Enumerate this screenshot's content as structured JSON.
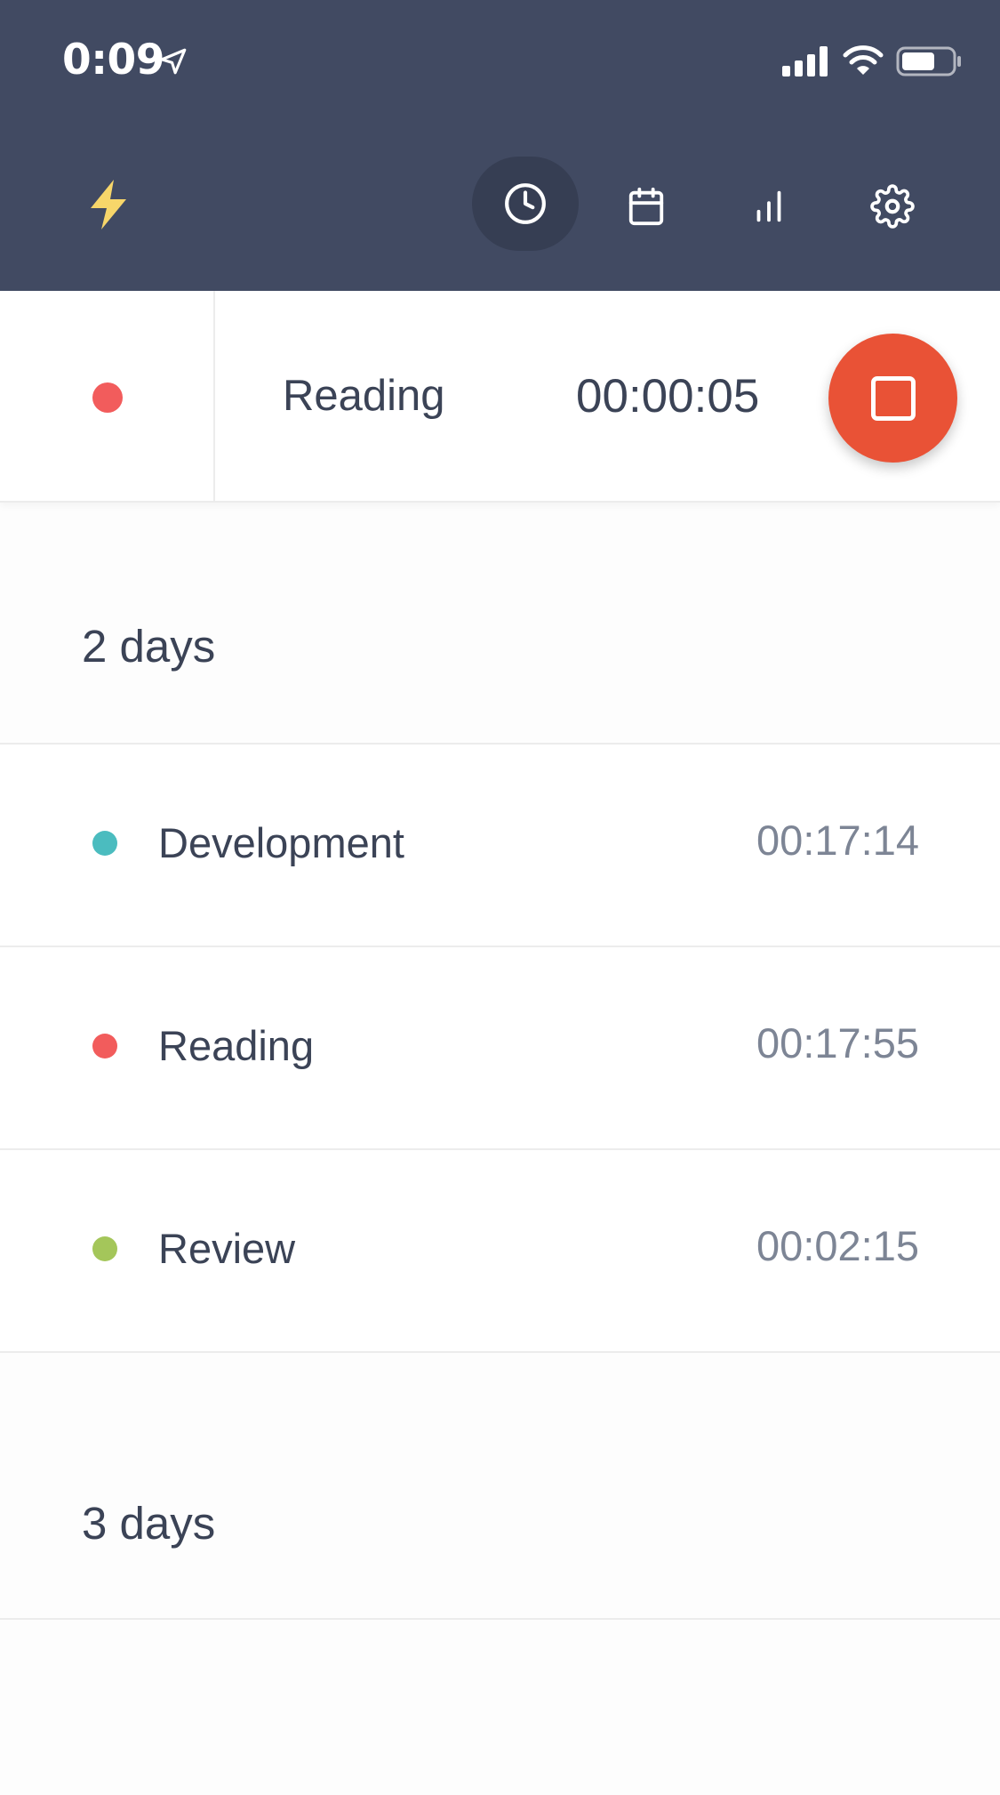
{
  "status_bar": {
    "time": "0:09"
  },
  "toolbar": {
    "logo_icon": "lightning-bolt-icon",
    "nav": [
      {
        "icon": "clock-icon",
        "active": true
      },
      {
        "icon": "calendar-icon",
        "active": false
      },
      {
        "icon": "bar-chart-icon",
        "active": false
      },
      {
        "icon": "gear-icon",
        "active": false
      }
    ]
  },
  "current_timer": {
    "project": "Reading",
    "elapsed": "00:00:05",
    "color": "#f25c5c",
    "stop_icon": "stop-icon"
  },
  "groups": [
    {
      "label": "2 days",
      "entries": [
        {
          "name": "Development",
          "duration": "00:17:14",
          "color": "#4bbcbf"
        },
        {
          "name": "Reading",
          "duration": "00:17:55",
          "color": "#f25c5c"
        },
        {
          "name": "Review",
          "duration": "00:02:15",
          "color": "#a4c65a"
        }
      ]
    },
    {
      "label": "3 days",
      "entries": []
    }
  ],
  "colors": {
    "header_bg": "#414a62",
    "active_nav_bg": "#363e53",
    "logo_yellow": "#f7d66a",
    "stop_button": "#e95236"
  }
}
